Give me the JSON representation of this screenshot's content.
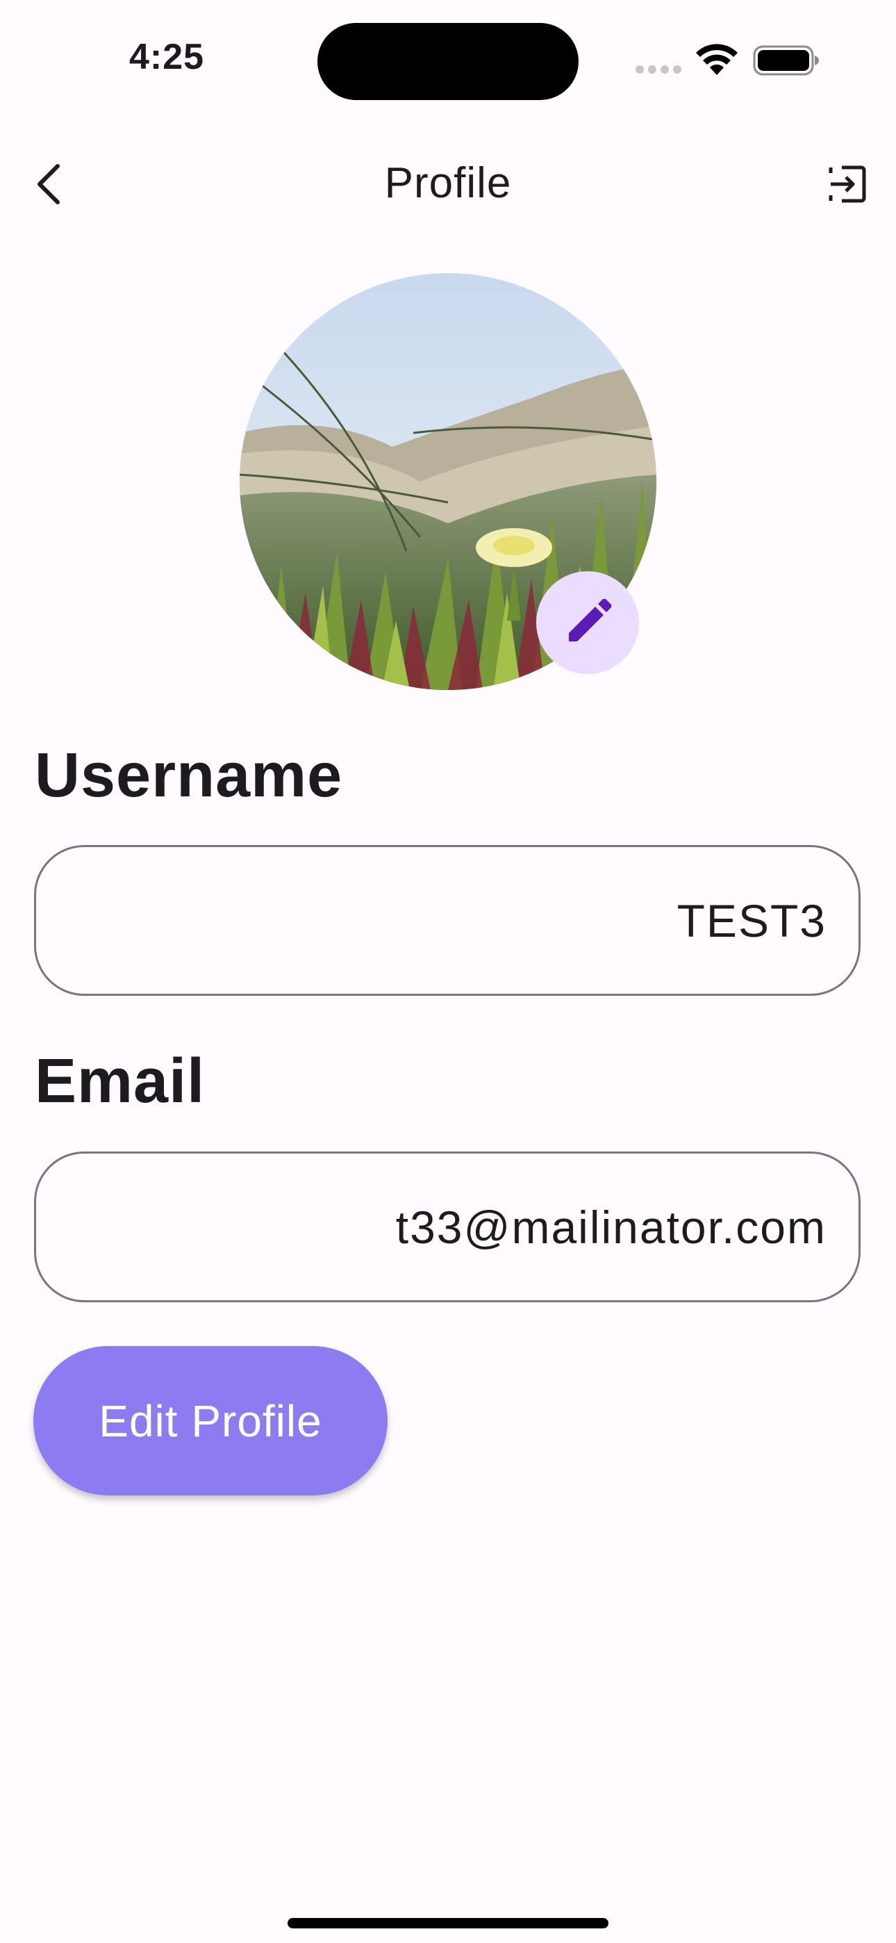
{
  "status_bar": {
    "time": "4:25",
    "icons": [
      "cellular-signal-icon",
      "wifi-icon",
      "battery-icon"
    ]
  },
  "app_bar": {
    "title": "Profile",
    "back_icon": "chevron-left-icon",
    "logout_icon": "logout-icon"
  },
  "avatar": {
    "edit_icon": "pencil-icon"
  },
  "form": {
    "username_label": "Username",
    "username_value": "TEST3",
    "email_label": "Email",
    "email_value": "t33@mailinator.com"
  },
  "actions": {
    "edit_profile_label": "Edit Profile"
  },
  "colors": {
    "background": "#fffbfe",
    "primary_button": "#8d7bf2",
    "avatar_edit_bg": "#eaddff",
    "avatar_edit_icon": "#5b1bb6",
    "field_border": "#79747e"
  }
}
